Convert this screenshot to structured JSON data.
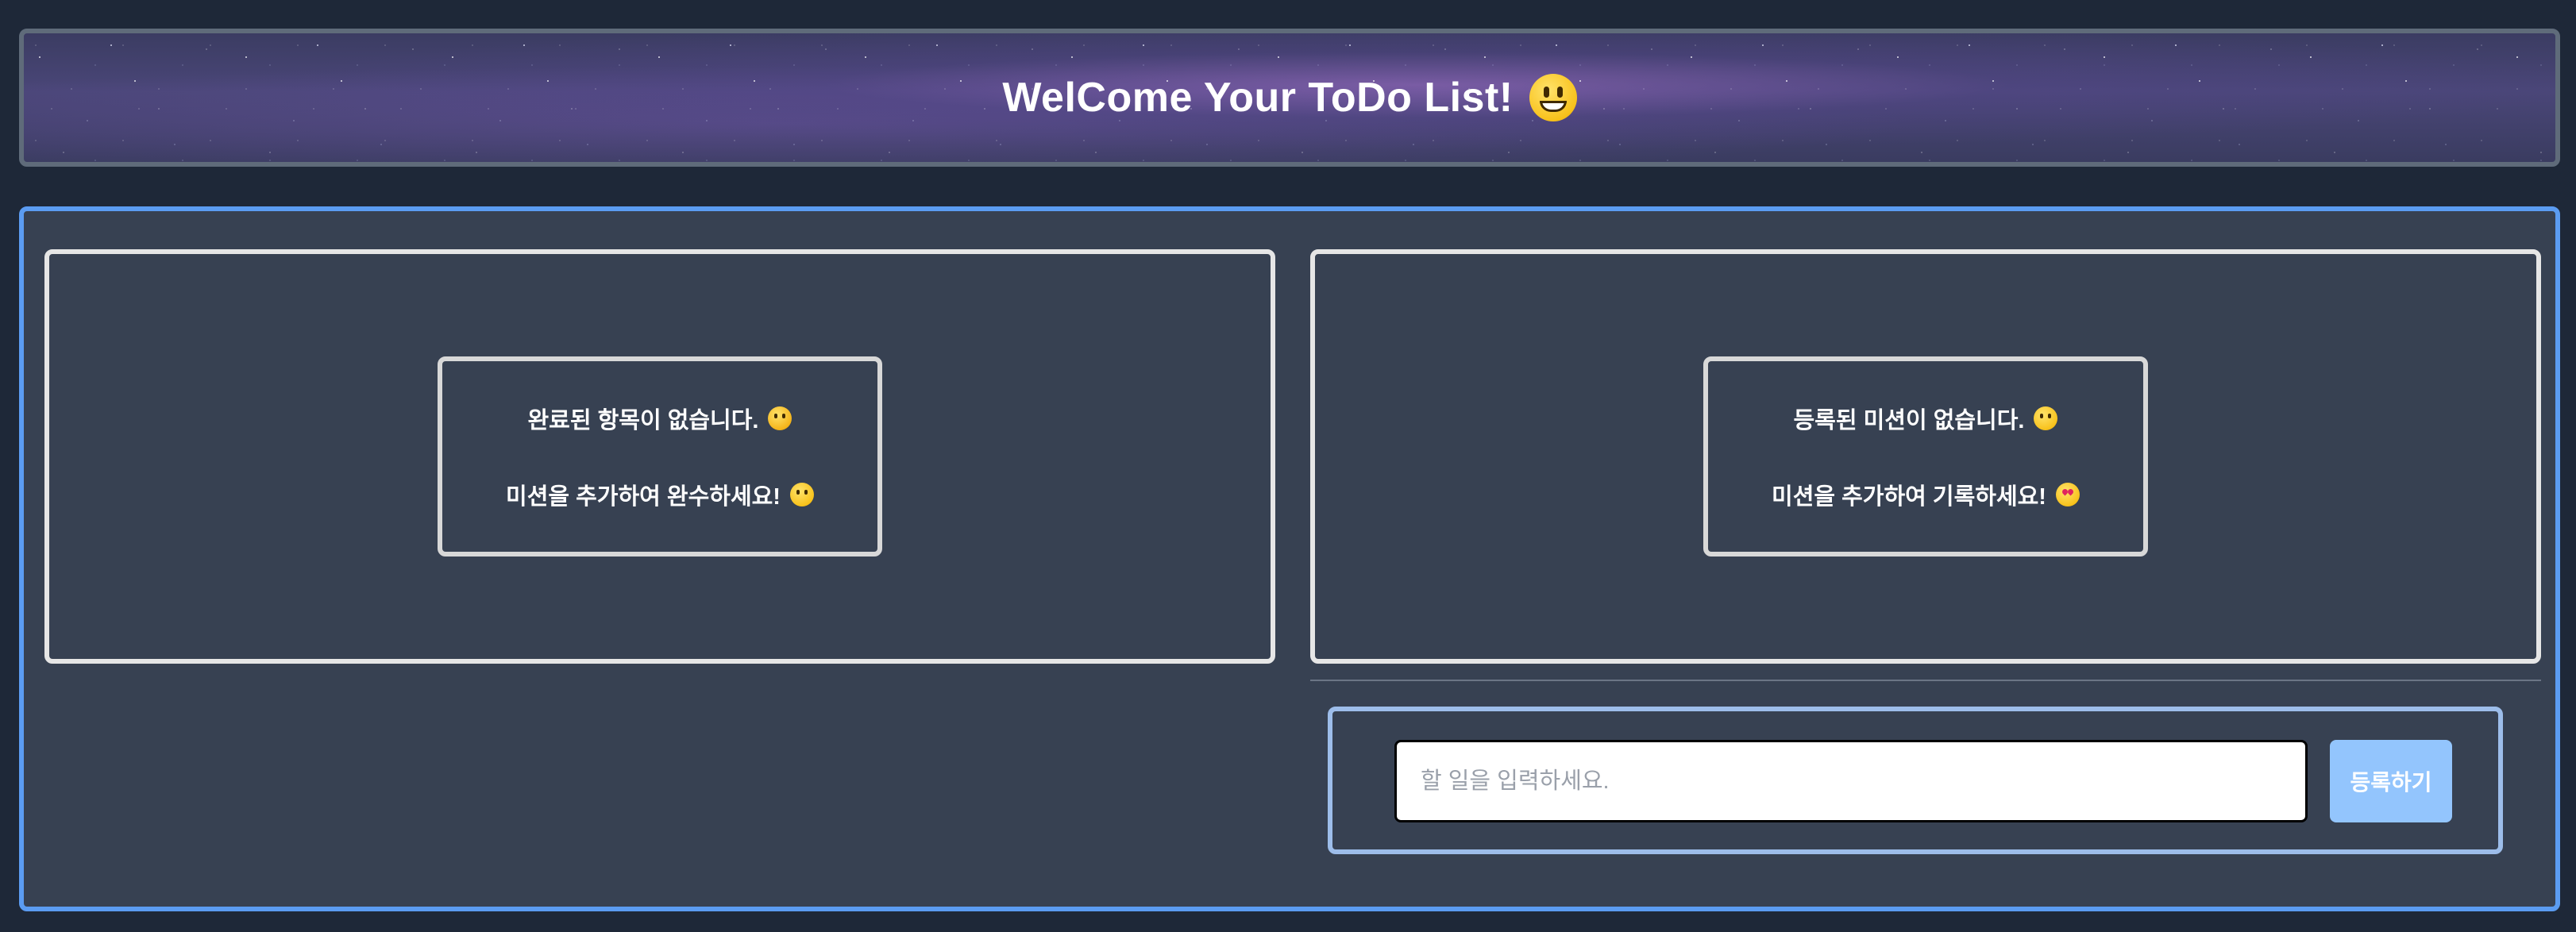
{
  "header": {
    "title": "WelCome Your ToDo List!",
    "title_emoji": "grinning-face-icon"
  },
  "completed_panel": {
    "line1": "완료된 항목이 없습니다.",
    "line1_emoji": "sad-face-icon",
    "line2": "미션을 추가하여 완수하세요!",
    "line2_emoji": "hugging-face-icon"
  },
  "registered_panel": {
    "line1": "등록된 미션이 없습니다.",
    "line1_emoji": "eye-roll-face-icon",
    "line2": "미션을 추가하여 기록하세요!",
    "line2_emoji": "heart-eyes-face-icon"
  },
  "form": {
    "placeholder": "할 일을 입력하세요.",
    "value": "",
    "submit_label": "등록하기"
  },
  "colors": {
    "background": "#1e2838",
    "panel": "#374152",
    "accent_border": "#5b9cf2",
    "button": "#93c5fd"
  }
}
